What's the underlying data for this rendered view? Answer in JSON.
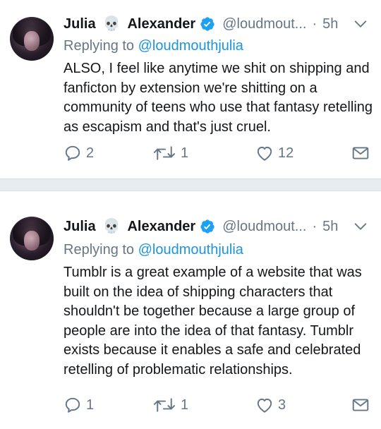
{
  "tweets": [
    {
      "name_first": "Julia",
      "name_emoji": "💀",
      "name_last": "Alexander",
      "handle": "@loudmout...",
      "dot": "·",
      "time": "5h",
      "replying_label": "Replying to",
      "replying_handle": "@loudmouthjulia",
      "text": "ALSO, I feel like anytime we shit on shipping and fanficton by extension we're shitting on a community of teens who use that fantasy retelling as escapism and that's just cruel.",
      "reply_count": "2",
      "retweet_count": "1",
      "like_count": "12"
    },
    {
      "name_first": "Julia",
      "name_emoji": "💀",
      "name_last": "Alexander",
      "handle": "@loudmout...",
      "dot": "·",
      "time": "5h",
      "replying_label": "Replying to",
      "replying_handle": "@loudmouthjulia",
      "text": "Tumblr is a great example of a website that was built on the idea of shipping characters that shouldn't be together because a large group of people are into the idea of that fantasy. Tumblr exists because it enables a safe and celebrated retelling of problematic relationships.",
      "reply_count": "1",
      "retweet_count": "1",
      "like_count": "3"
    }
  ],
  "icons": {
    "verified": "verified-badge-icon",
    "caret": "chevron-down-icon",
    "reply": "reply-icon",
    "retweet": "retweet-icon",
    "like": "heart-icon",
    "dm": "envelope-icon"
  },
  "colors": {
    "accent": "#1b95e0",
    "muted": "#657786",
    "text": "#14171a",
    "separator": "#e6ecf0"
  }
}
